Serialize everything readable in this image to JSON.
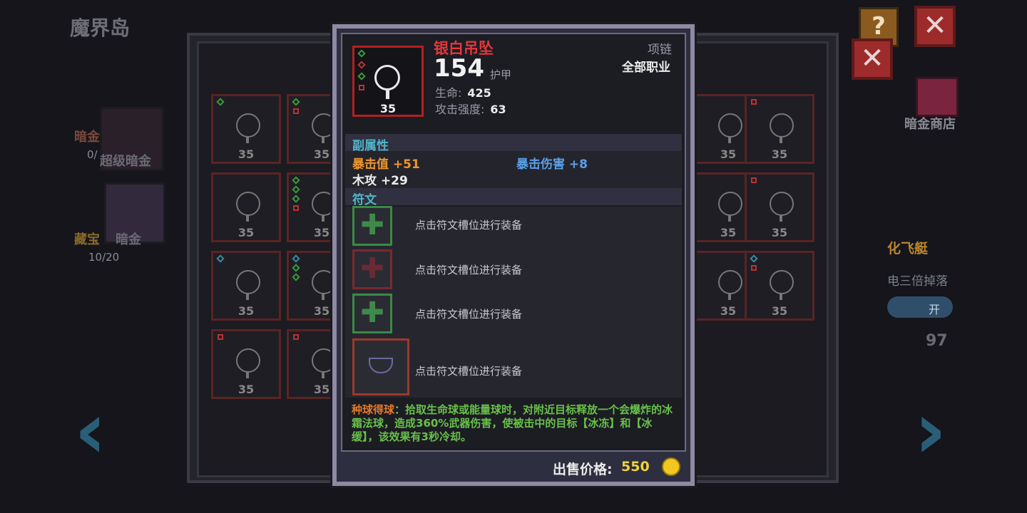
{
  "background": {
    "map_title": "魔界岛",
    "left_menu": [
      {
        "label": "暗金",
        "sub_label": "超级暗金",
        "count": "0/"
      },
      {
        "label": "藏宝",
        "sub_label": "暗金",
        "count": "10/20"
      }
    ],
    "slot_level": "35",
    "right_menu": {
      "shop_label": "暗金商店",
      "feature_title": "化飞艇",
      "feature_desc": "电三倍掉落",
      "toggle_label": "开",
      "counter": "97"
    }
  },
  "item": {
    "name": "银白吊坠",
    "level": "35",
    "main_value": "154",
    "main_value_label": "护甲",
    "type": "项链",
    "class_req": "全部职业",
    "base_stats": [
      {
        "label": "生命:",
        "value": "425"
      },
      {
        "label": "攻击强度:",
        "value": "63"
      }
    ],
    "sub_attr_title": "副属性",
    "sub_attrs": [
      {
        "label": "暴击值",
        "value": "+51",
        "color": "#f0962a"
      },
      {
        "label": "暴击伤害",
        "value": "+8",
        "color": "#5aa0e8"
      },
      {
        "label": "木攻",
        "value": "+29",
        "color": "#ececec"
      }
    ],
    "rune_title": "符文",
    "runes": [
      {
        "type": "green",
        "text": "点击符文槽位进行装备"
      },
      {
        "type": "red",
        "text": "点击符文槽位进行装备"
      },
      {
        "type": "green",
        "text": "点击符文槽位进行装备"
      },
      {
        "type": "special",
        "text": "点击符文槽位进行装备"
      }
    ],
    "description": {
      "effect_name": "种球得球",
      "effect_text": "：拾取生命球或能量球时，对附近目标释放一个会爆炸的冰霜法球，造成360%武器伤害，使被击中的目标【冰冻】和【冰缓】，该效果有3秒冷却。"
    },
    "sell_label": "出售价格:",
    "sell_price": "550"
  },
  "colors": {
    "rarity_red": "#e0383a",
    "accent_cyan": "#4fb6c8",
    "desc_green": "#68c04a",
    "gold": "#f1d23a"
  }
}
